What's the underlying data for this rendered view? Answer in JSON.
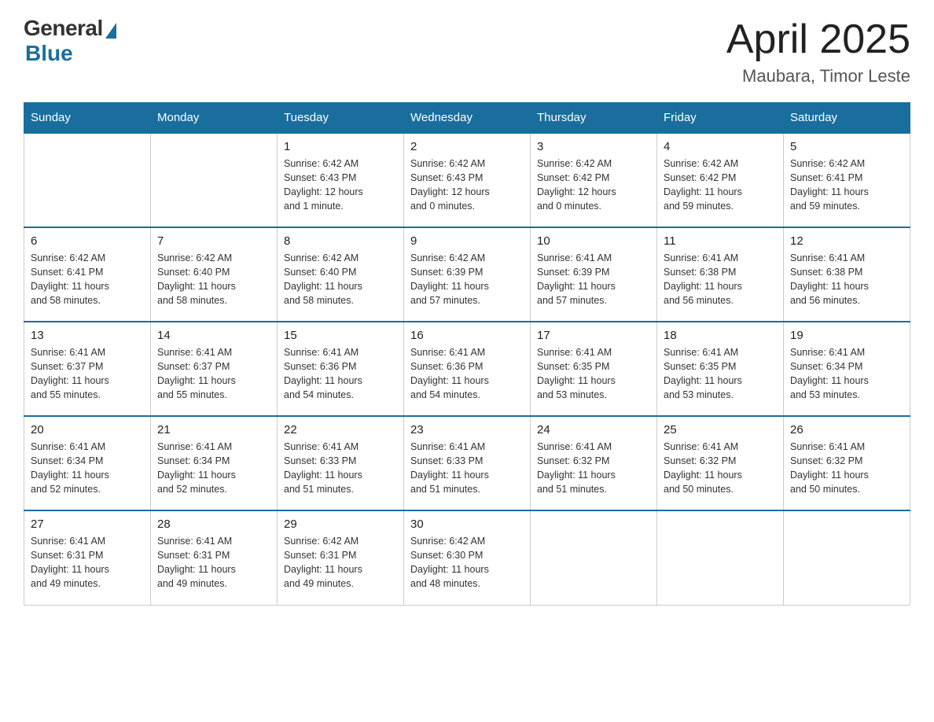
{
  "header": {
    "logo_general": "General",
    "logo_blue": "Blue",
    "title": "April 2025",
    "subtitle": "Maubara, Timor Leste"
  },
  "days_of_week": [
    "Sunday",
    "Monday",
    "Tuesday",
    "Wednesday",
    "Thursday",
    "Friday",
    "Saturday"
  ],
  "weeks": [
    [
      {
        "day": "",
        "info": ""
      },
      {
        "day": "",
        "info": ""
      },
      {
        "day": "1",
        "info": "Sunrise: 6:42 AM\nSunset: 6:43 PM\nDaylight: 12 hours\nand 1 minute."
      },
      {
        "day": "2",
        "info": "Sunrise: 6:42 AM\nSunset: 6:43 PM\nDaylight: 12 hours\nand 0 minutes."
      },
      {
        "day": "3",
        "info": "Sunrise: 6:42 AM\nSunset: 6:42 PM\nDaylight: 12 hours\nand 0 minutes."
      },
      {
        "day": "4",
        "info": "Sunrise: 6:42 AM\nSunset: 6:42 PM\nDaylight: 11 hours\nand 59 minutes."
      },
      {
        "day": "5",
        "info": "Sunrise: 6:42 AM\nSunset: 6:41 PM\nDaylight: 11 hours\nand 59 minutes."
      }
    ],
    [
      {
        "day": "6",
        "info": "Sunrise: 6:42 AM\nSunset: 6:41 PM\nDaylight: 11 hours\nand 58 minutes."
      },
      {
        "day": "7",
        "info": "Sunrise: 6:42 AM\nSunset: 6:40 PM\nDaylight: 11 hours\nand 58 minutes."
      },
      {
        "day": "8",
        "info": "Sunrise: 6:42 AM\nSunset: 6:40 PM\nDaylight: 11 hours\nand 58 minutes."
      },
      {
        "day": "9",
        "info": "Sunrise: 6:42 AM\nSunset: 6:39 PM\nDaylight: 11 hours\nand 57 minutes."
      },
      {
        "day": "10",
        "info": "Sunrise: 6:41 AM\nSunset: 6:39 PM\nDaylight: 11 hours\nand 57 minutes."
      },
      {
        "day": "11",
        "info": "Sunrise: 6:41 AM\nSunset: 6:38 PM\nDaylight: 11 hours\nand 56 minutes."
      },
      {
        "day": "12",
        "info": "Sunrise: 6:41 AM\nSunset: 6:38 PM\nDaylight: 11 hours\nand 56 minutes."
      }
    ],
    [
      {
        "day": "13",
        "info": "Sunrise: 6:41 AM\nSunset: 6:37 PM\nDaylight: 11 hours\nand 55 minutes."
      },
      {
        "day": "14",
        "info": "Sunrise: 6:41 AM\nSunset: 6:37 PM\nDaylight: 11 hours\nand 55 minutes."
      },
      {
        "day": "15",
        "info": "Sunrise: 6:41 AM\nSunset: 6:36 PM\nDaylight: 11 hours\nand 54 minutes."
      },
      {
        "day": "16",
        "info": "Sunrise: 6:41 AM\nSunset: 6:36 PM\nDaylight: 11 hours\nand 54 minutes."
      },
      {
        "day": "17",
        "info": "Sunrise: 6:41 AM\nSunset: 6:35 PM\nDaylight: 11 hours\nand 53 minutes."
      },
      {
        "day": "18",
        "info": "Sunrise: 6:41 AM\nSunset: 6:35 PM\nDaylight: 11 hours\nand 53 minutes."
      },
      {
        "day": "19",
        "info": "Sunrise: 6:41 AM\nSunset: 6:34 PM\nDaylight: 11 hours\nand 53 minutes."
      }
    ],
    [
      {
        "day": "20",
        "info": "Sunrise: 6:41 AM\nSunset: 6:34 PM\nDaylight: 11 hours\nand 52 minutes."
      },
      {
        "day": "21",
        "info": "Sunrise: 6:41 AM\nSunset: 6:34 PM\nDaylight: 11 hours\nand 52 minutes."
      },
      {
        "day": "22",
        "info": "Sunrise: 6:41 AM\nSunset: 6:33 PM\nDaylight: 11 hours\nand 51 minutes."
      },
      {
        "day": "23",
        "info": "Sunrise: 6:41 AM\nSunset: 6:33 PM\nDaylight: 11 hours\nand 51 minutes."
      },
      {
        "day": "24",
        "info": "Sunrise: 6:41 AM\nSunset: 6:32 PM\nDaylight: 11 hours\nand 51 minutes."
      },
      {
        "day": "25",
        "info": "Sunrise: 6:41 AM\nSunset: 6:32 PM\nDaylight: 11 hours\nand 50 minutes."
      },
      {
        "day": "26",
        "info": "Sunrise: 6:41 AM\nSunset: 6:32 PM\nDaylight: 11 hours\nand 50 minutes."
      }
    ],
    [
      {
        "day": "27",
        "info": "Sunrise: 6:41 AM\nSunset: 6:31 PM\nDaylight: 11 hours\nand 49 minutes."
      },
      {
        "day": "28",
        "info": "Sunrise: 6:41 AM\nSunset: 6:31 PM\nDaylight: 11 hours\nand 49 minutes."
      },
      {
        "day": "29",
        "info": "Sunrise: 6:42 AM\nSunset: 6:31 PM\nDaylight: 11 hours\nand 49 minutes."
      },
      {
        "day": "30",
        "info": "Sunrise: 6:42 AM\nSunset: 6:30 PM\nDaylight: 11 hours\nand 48 minutes."
      },
      {
        "day": "",
        "info": ""
      },
      {
        "day": "",
        "info": ""
      },
      {
        "day": "",
        "info": ""
      }
    ]
  ]
}
